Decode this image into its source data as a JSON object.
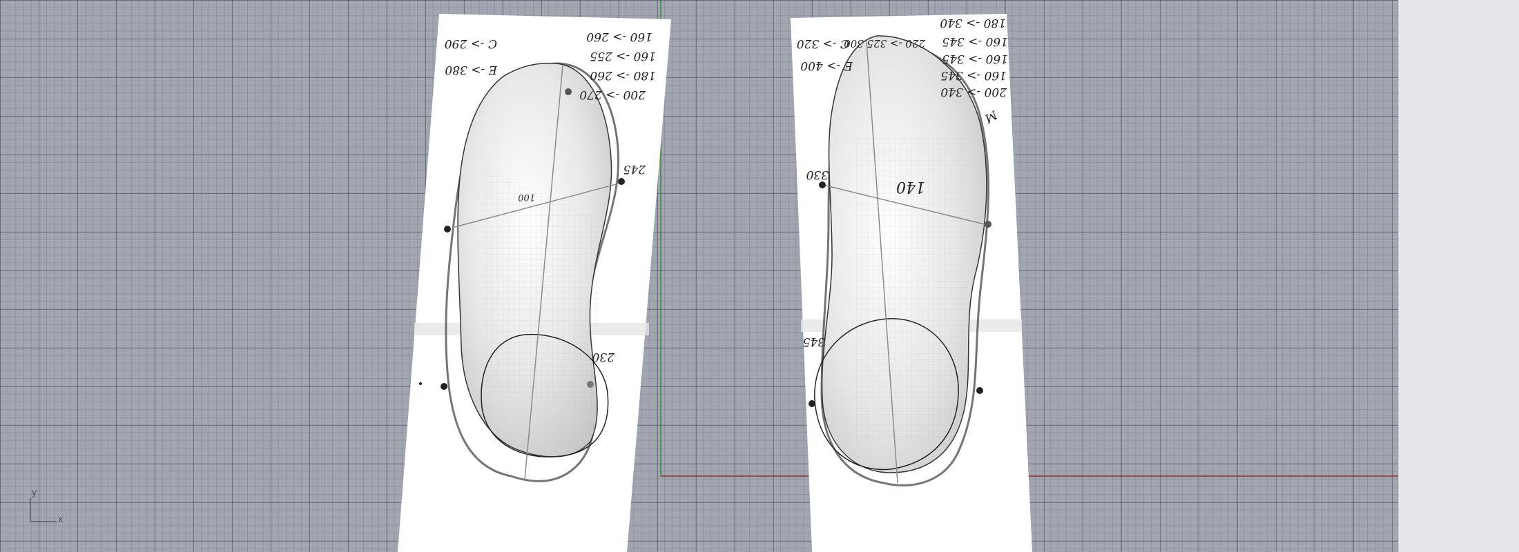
{
  "viewport": {
    "axis_labels": {
      "y": "y",
      "x": "x"
    },
    "colors": {
      "grid_background": "#a2a6b0",
      "x_axis": "#9a2a30",
      "y_axis": "#3a8a3a",
      "paper": "#ffffff"
    }
  },
  "left_scan": {
    "notes": {
      "line1": "160 -> 260",
      "line2": "160 -> 255",
      "line3": "180 -> 260",
      "line4": "200 -> 270",
      "c_note": "C -> 290",
      "e_note": "E -> 380",
      "v245": "245",
      "v230": "230",
      "v100": "100"
    }
  },
  "right_scan": {
    "notes": {
      "line1": "180 -> 340",
      "line2": "160 -> 345",
      "line3": "160 -> 345",
      "line4": "160 -> 345",
      "line5": "200 -> 340",
      "c_note": "C -> 320",
      "e_note": "E -> 400",
      "top_note": "220 -> 325 300",
      "v330": "330",
      "v345": "345",
      "m_note": "M",
      "center": "140"
    }
  }
}
